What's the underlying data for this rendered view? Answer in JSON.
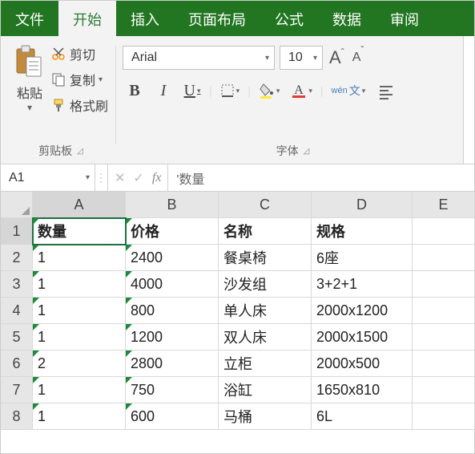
{
  "tabs": {
    "file": "文件",
    "home": "开始",
    "insert": "插入",
    "layout": "页面布局",
    "formulas": "公式",
    "data": "数据",
    "review": "审阅"
  },
  "ribbon": {
    "clipboard": {
      "paste": "粘贴",
      "cut": "剪切",
      "copy": "复制",
      "format_painter": "格式刷",
      "group_label": "剪贴板"
    },
    "font": {
      "name": "Arial",
      "size": "10",
      "group_label": "字体",
      "wen_char": "文",
      "wen_pin": "wén"
    }
  },
  "formula_bar": {
    "name_box": "A1",
    "fx_label": "fx",
    "value": "'数量"
  },
  "grid": {
    "columns": [
      "A",
      "B",
      "C",
      "D",
      "E"
    ],
    "rows": [
      "1",
      "2",
      "3",
      "4",
      "5",
      "6",
      "7",
      "8"
    ],
    "header": {
      "qty": "数量",
      "price": "价格",
      "name": "名称",
      "spec": "规格"
    },
    "data": [
      {
        "qty": "1",
        "price": "2400",
        "name": "餐桌椅",
        "spec": "6座"
      },
      {
        "qty": "1",
        "price": "4000",
        "name": "沙发组",
        "spec": "3+2+1"
      },
      {
        "qty": "1",
        "price": "800",
        "name": "单人床",
        "spec": "2000x1200"
      },
      {
        "qty": "1",
        "price": "1200",
        "name": "双人床",
        "spec": "2000x1500"
      },
      {
        "qty": "2",
        "price": "2800",
        "name": "立柜",
        "spec": "2000x500"
      },
      {
        "qty": "1",
        "price": "750",
        "name": "浴缸",
        "spec": "1650x810"
      },
      {
        "qty": "1",
        "price": "600",
        "name": "马桶",
        "spec": "6L"
      }
    ]
  }
}
